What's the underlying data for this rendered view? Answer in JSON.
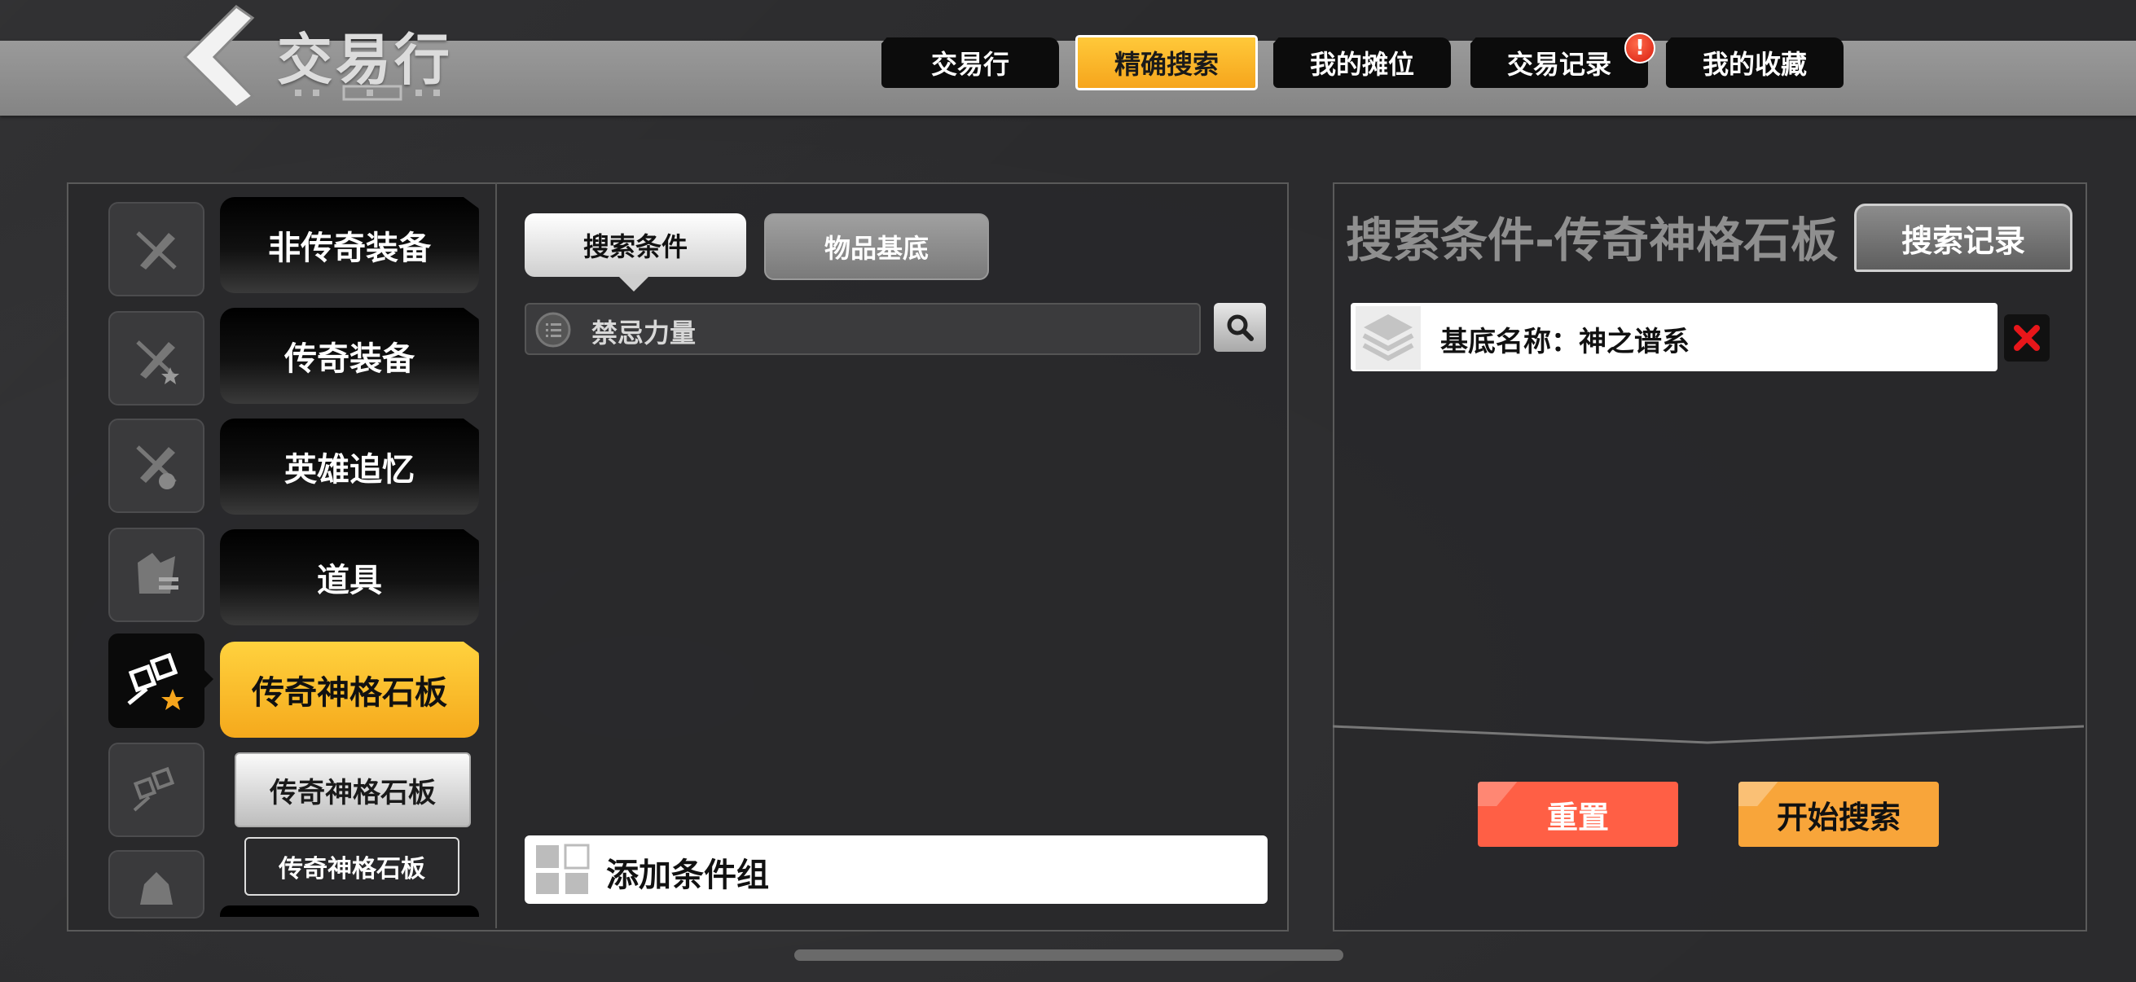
{
  "header": {
    "title": "交易行",
    "tabs": [
      {
        "label": "交易行",
        "active": false
      },
      {
        "label": "精确搜索",
        "active": true
      },
      {
        "label": "我的摊位",
        "active": false
      },
      {
        "label": "交易记录",
        "active": false,
        "badge": "!"
      },
      {
        "label": "我的收藏",
        "active": false
      }
    ]
  },
  "categories": [
    {
      "label": "非传奇装备",
      "icon": "crossed-sword-icon"
    },
    {
      "label": "传奇装备",
      "icon": "crossed-sword-star-icon"
    },
    {
      "label": "英雄追忆",
      "icon": "crossed-sword-hero-icon"
    },
    {
      "label": "道具",
      "icon": "item-bag-icon"
    },
    {
      "label": "传奇神格石板",
      "icon": "divinity-slate-star-icon",
      "active": true
    }
  ],
  "subcategories": [
    {
      "label": "传奇神格石板"
    },
    {
      "label": "传奇神格石板"
    }
  ],
  "middle": {
    "segment_search": "搜索条件",
    "segment_base": "物品基底",
    "search_value": "禁忌力量",
    "add_group_label": "添加条件组"
  },
  "right": {
    "title": "搜索条件-传奇神格石板",
    "history_button": "搜索记录",
    "condition_text": "基底名称：神之谱系",
    "reset_button": "重置",
    "start_button": "开始搜索"
  },
  "colors": {
    "accent_yellow": "#f6a51c",
    "reset_red": "#ff5f45",
    "start_orange": "#f8a53a",
    "delete_red": "#e8161a"
  }
}
